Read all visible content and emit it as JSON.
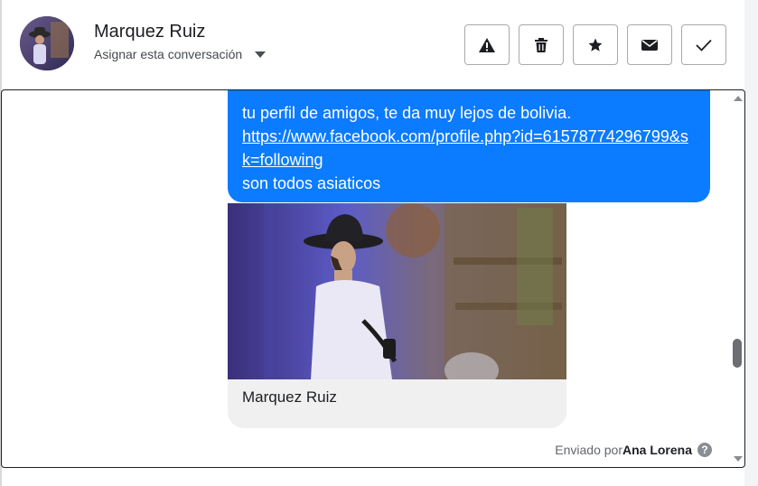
{
  "header": {
    "contact_name": "Marquez Ruiz",
    "assign_label": "Asignar esta conversación",
    "actions": [
      {
        "icon": "warning-icon"
      },
      {
        "icon": "trash-icon"
      },
      {
        "icon": "star-icon"
      },
      {
        "icon": "mail-icon"
      },
      {
        "icon": "check-icon"
      }
    ]
  },
  "message": {
    "line1": "tu perfil de amigos, te da muy lejos de bolivia.",
    "link": "https://www.facebook.com/profile.php?id=61578774296799&sk=following",
    "line3": "son todos asiaticos",
    "bubble_color": "#0b7bff"
  },
  "card": {
    "title": "Marquez Ruiz"
  },
  "footer": {
    "sent_by_prefix": "Enviado por",
    "sent_by_name": "Ana Lorena",
    "help_glyph": "?"
  }
}
